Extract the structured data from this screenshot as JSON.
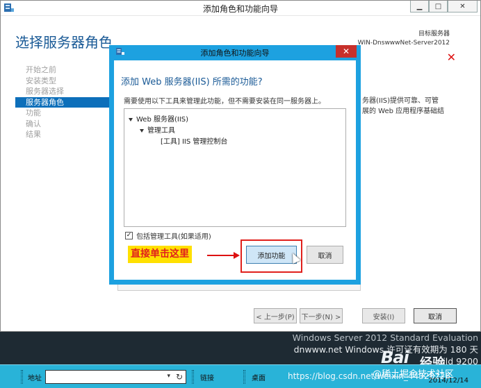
{
  "outer_window": {
    "title": "添加角色和功能向导",
    "controls": [
      "▁",
      "□",
      "✕"
    ],
    "page_title": "选择服务器角色",
    "target_label": "目标服务器",
    "target_server": "WIN-DnswwwNet-Server2012",
    "nav_items": [
      "开始之前",
      "安装类型",
      "服务器选择",
      "服务器角色",
      "功能",
      "确认",
      "结果"
    ],
    "side_text_1": "务器(IIS)提供可靠、可管",
    "side_text_2": "展的 Web 应用程序基础结",
    "buttons": {
      "prev": "< 上一步(P)",
      "next": "下一步(N) >",
      "install": "安装(I)",
      "cancel": "取消"
    }
  },
  "dialog": {
    "title": "添加角色和功能向导",
    "close": "✕",
    "heading": "添加 Web 服务器(IIS) 所需的功能?",
    "description": "需要使用以下工具来管理此功能，但不需要安装在同一服务器上。",
    "tree": [
      "Web 服务器(IIS)",
      "管理工具",
      "[工具] IIS 管理控制台"
    ],
    "include_tools_checkbox": {
      "label": "包括管理工具(如果适用)",
      "checked": "✓"
    },
    "add_features_button": "添加功能",
    "cancel_button": "取消"
  },
  "annotation": {
    "callout_text": "直接单击这里"
  },
  "desktop": {
    "line1": "Windows Server 2012 Standard Evaluation",
    "line2": "dnwww.net Windows 许可证有效期为 180 天",
    "line3": "uild 9200"
  },
  "taskbar": {
    "address_label": "地址",
    "links_label": "链接",
    "desktop_label": "桌面",
    "watermark": "https://blog.csdn.net/weixin_44328226",
    "watermark2": "@稀土掘金技术社区",
    "date": "2014/12/14",
    "baidu": "Bai",
    "baidu_sub": "经验"
  }
}
